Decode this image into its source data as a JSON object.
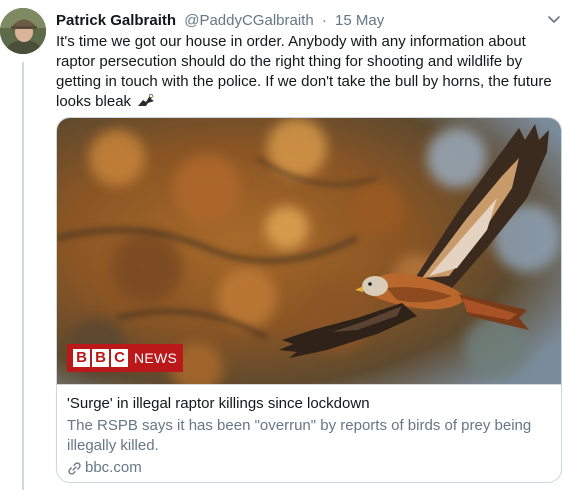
{
  "tweet": {
    "author_name": "Patrick Galbraith",
    "author_handle": "@PaddyCGalbraith",
    "separator": "·",
    "date": "15 May",
    "text": "It's time we got our house in order. Anybody with any information about raptor persecution should do the right thing for shooting and wildlife by getting in touch with the police. If we don't take the bull by horns, the future looks bleak",
    "emoji_icon": "eagle-icon",
    "menu_icon": "chevron-down-icon"
  },
  "card": {
    "image_icon": "red-kite-photo",
    "logo_letters": [
      "B",
      "B",
      "C"
    ],
    "logo_word": "NEWS",
    "title": "'Surge' in illegal raptor killings since lockdown",
    "description": "The RSPB says it has been \"overrun\" by reports of birds of prey being illegally killed.",
    "domain": "bbc.com",
    "domain_icon": "link-icon"
  },
  "colors": {
    "text": "#14171a",
    "secondary": "#657786",
    "border": "#ccd6dd",
    "bbc_red": "#bb1919"
  }
}
